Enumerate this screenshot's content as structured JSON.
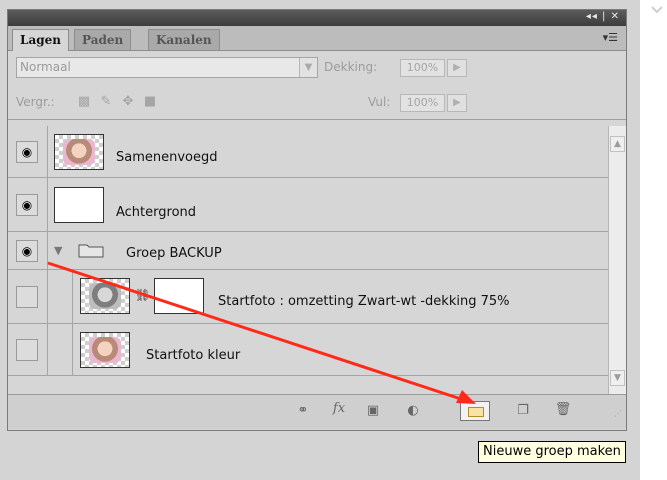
{
  "panel": {
    "titlebar_buttons": "◂◂ | ✕",
    "tabs": [
      {
        "label": "Lagen",
        "active": true
      },
      {
        "label": "Paden",
        "active": false
      },
      {
        "label": "Kanalen",
        "active": false
      }
    ],
    "panel_menu_icon": "panel-menu-icon"
  },
  "blend": {
    "mode_value": "Normaal",
    "opacity_label": "Dekking:",
    "opacity_value": "100%",
    "lock_label": "Vergr.:",
    "fill_label": "Vul:",
    "fill_value": "100%"
  },
  "layers": [
    {
      "name": "Samenenvoegd",
      "visible": true,
      "thumb": "color-photo"
    },
    {
      "name": "Achtergrond",
      "visible": true,
      "thumb": "white"
    },
    {
      "name": "Groep BACKUP",
      "visible": true,
      "type": "group",
      "expanded": true
    },
    {
      "name": "Startfoto : omzetting Zwart-wt -dekking 75%",
      "visible": false,
      "thumb": "grey-photo",
      "has_mask": true
    },
    {
      "name": "Startfoto kleur",
      "visible": false,
      "thumb": "color-photo"
    }
  ],
  "bottom_icons": [
    "link-icon",
    "fx-icon",
    "mask-icon",
    "adjustment-icon",
    "new-group-icon",
    "new-layer-icon",
    "trash-icon"
  ],
  "fx_label": "fx",
  "tooltip": "Nieuwe groep maken",
  "colors": {
    "annotation_arrow": "#ff2a1a",
    "tooltip_bg": "#ffffe1"
  }
}
